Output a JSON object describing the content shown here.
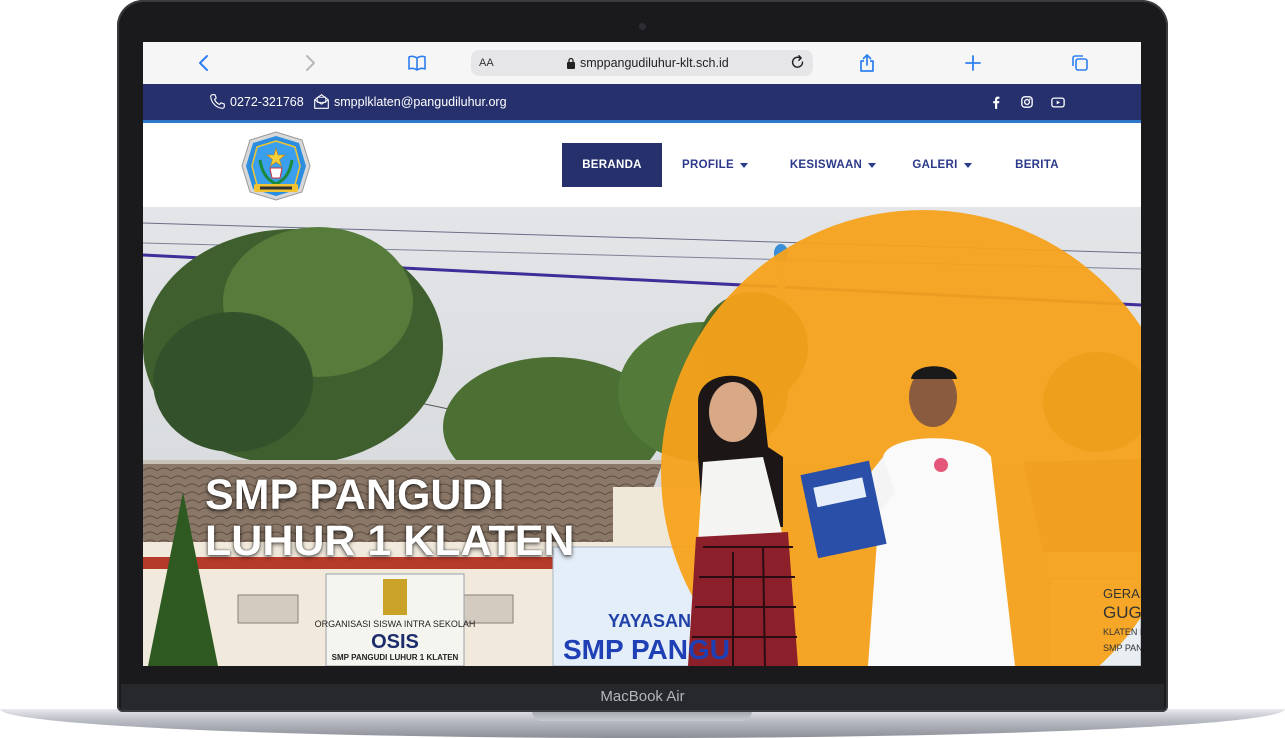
{
  "device": {
    "brand": "MacBook Air"
  },
  "browser": {
    "text_size_label": "AA",
    "url": "smppangudiluhur-klt.sch.id",
    "icons": [
      "chevron-left-icon",
      "chevron-right-icon",
      "book-icon",
      "lock-icon",
      "reload-icon",
      "share-icon",
      "plus-icon",
      "tabs-icon"
    ]
  },
  "topbar": {
    "phone": "0272-321768",
    "email": "smpplklaten@pangudiluhur.org",
    "social": [
      "facebook-icon",
      "instagram-icon",
      "youtube-icon"
    ]
  },
  "nav": {
    "items": [
      {
        "label": "BERANDA",
        "active": true,
        "dropdown": false
      },
      {
        "label": "PROFILE",
        "active": false,
        "dropdown": true
      },
      {
        "label": "KESISWAAN",
        "active": false,
        "dropdown": true
      },
      {
        "label": "GALERI",
        "active": false,
        "dropdown": true
      },
      {
        "label": "BERITA",
        "active": false,
        "dropdown": false
      }
    ]
  },
  "hero": {
    "title_line1": "SMP PANGUDI",
    "title_line2": "LUHUR 1 KLATEN",
    "sign_osis_small": "ORGANISASI SISWA INTRA SEKOLAH",
    "sign_osis_big": "OSIS",
    "sign_osis_school": "SMP PANGUDI LUHUR 1 KLATEN",
    "sign_yayasan": "YAYASAN",
    "sign_yayasan_school": "SMP PANGU",
    "sign_right_1": "GERAKAN",
    "sign_right_2": "GUGUS",
    "sign_right_3": "KLATEN No.",
    "sign_right_4": "SMP PANGUDI"
  },
  "colors": {
    "navy": "#26306c",
    "accent_blue": "#2f78c9",
    "orange": "#f7a21b",
    "nav_text": "#2b3a8a"
  }
}
